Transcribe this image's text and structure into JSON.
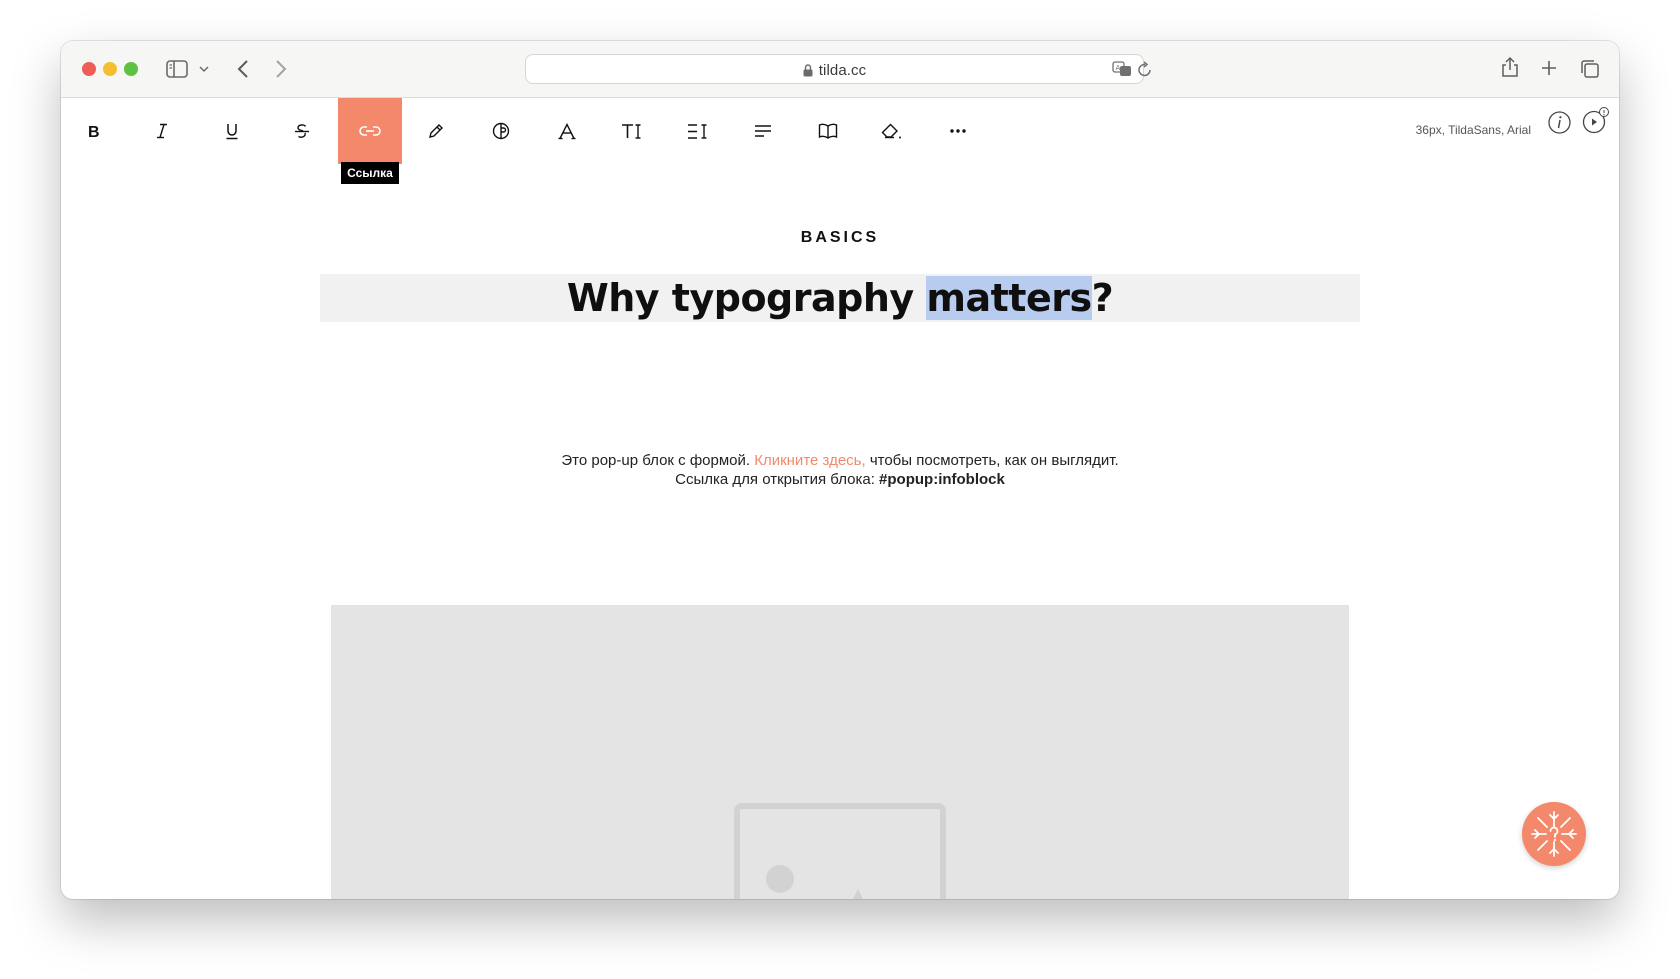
{
  "browser": {
    "url": "tilda.cc",
    "icons": {
      "sidebar": "sidebar-icon",
      "sidebar_menu": "chevron-down-icon",
      "back": "chevron-left-icon",
      "forward": "chevron-right-icon",
      "lock": "lock-icon",
      "translate": "translate-icon",
      "reload": "reload-icon",
      "share": "share-icon",
      "new_tab": "plus-icon",
      "tabs": "tabs-icon"
    }
  },
  "toolbar": {
    "tools": [
      {
        "name": "bold",
        "icon": "bold-icon"
      },
      {
        "name": "italic",
        "icon": "italic-icon"
      },
      {
        "name": "underline",
        "icon": "underline-icon"
      },
      {
        "name": "strikethrough",
        "icon": "strikethrough-icon"
      },
      {
        "name": "link",
        "icon": "link-icon",
        "active": true
      },
      {
        "name": "color",
        "icon": "pencil-icon"
      },
      {
        "name": "typography",
        "icon": "font-circle-icon"
      },
      {
        "name": "font",
        "icon": "font-a-icon"
      },
      {
        "name": "font-size",
        "icon": "text-size-icon"
      },
      {
        "name": "line-height",
        "icon": "line-height-icon"
      },
      {
        "name": "align",
        "icon": "align-icon"
      },
      {
        "name": "dictionary",
        "icon": "book-icon"
      },
      {
        "name": "clear-format",
        "icon": "eraser-icon"
      },
      {
        "name": "more",
        "icon": "more-icon"
      }
    ],
    "tooltip": "Ссылка",
    "font_info": "36px, TildaSans, Arial",
    "accent_color": "#f3896a"
  },
  "content": {
    "overline": "BASICS",
    "heading": {
      "before": "Why typography ",
      "selected": "matters",
      "after": "?"
    },
    "description": {
      "line1_before": "Это pop-up блок с формой. ",
      "line1_link": "Кликните здесь,",
      "line1_after": " чтобы посмотреть, как он выглядит.",
      "line2_before": "Ссылка для открытия блока: ",
      "line2_bold": "#popup:infoblock"
    },
    "image_icon": "image-placeholder-icon"
  },
  "help_button": {
    "icon": "snowflake-help-icon"
  }
}
